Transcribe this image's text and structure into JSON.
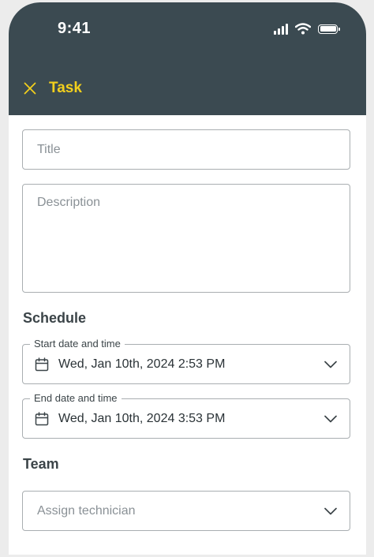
{
  "status_bar": {
    "time": "9:41"
  },
  "nav": {
    "title": "Task"
  },
  "form": {
    "title_placeholder": "Title",
    "description_placeholder": "Description",
    "schedule_heading": "Schedule",
    "start": {
      "label": "Start date and time",
      "value": "Wed, Jan 10th, 2024 2:53 PM"
    },
    "end": {
      "label": "End date and time",
      "value": "Wed, Jan 10th, 2024 3:53 PM"
    },
    "team_heading": "Team",
    "technician_placeholder": "Assign technician"
  },
  "colors": {
    "header_bg": "#3b4a51",
    "accent": "#f2cf1d"
  },
  "icons": [
    "signal-icon",
    "wifi-icon",
    "battery-icon",
    "close-icon",
    "calendar-icon",
    "chevron-down-icon"
  ]
}
